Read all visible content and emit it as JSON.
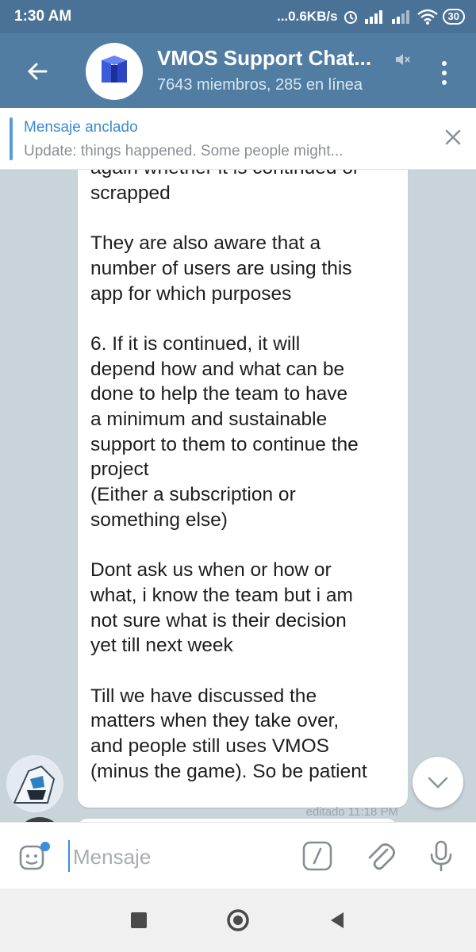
{
  "status_bar": {
    "time": "1:30 AM",
    "speed": "...0.6KB/s",
    "battery": "30"
  },
  "header": {
    "title": "VMOS Support Chat...",
    "subtitle": "7643 miembros, 285 en línea"
  },
  "pinned": {
    "title": "Mensaje anclado",
    "text": "Update: things happened.  Some people might..."
  },
  "message": {
    "text": "again whether it is continued or\nscrapped\n\nThey are also aware that a\nnumber of users are using this\napp for which purposes\n\n6. If it is continued, it will\ndepend how and what can be\ndone to help the team to have\na minimum and sustainable\nsupport to them to continue the\nproject\n(Either a subscription or\nsomething else)\n\nDont ask us when or how or\nwhat, i know the team but i am\nnot sure what is their decision\nyet till next week\n\nTill we have discussed the\nmatters when they take over,\nand people still uses VMOS\n(minus the game). So be patient",
    "meta": "editado 11:18 PM"
  },
  "input": {
    "placeholder": "Mensaje"
  },
  "colors": {
    "header": "#527da3",
    "status_bar": "#4a7297",
    "accent": "#3c8bd0",
    "chat_bg": "#c9d3da"
  },
  "icons": [
    "back-arrow-icon",
    "mute-icon",
    "more-vert-icon",
    "close-icon",
    "chevron-down-icon",
    "sticker-icon",
    "command-icon",
    "paperclip-icon",
    "microphone-icon",
    "recent-apps-icon",
    "home-icon",
    "back-icon"
  ]
}
